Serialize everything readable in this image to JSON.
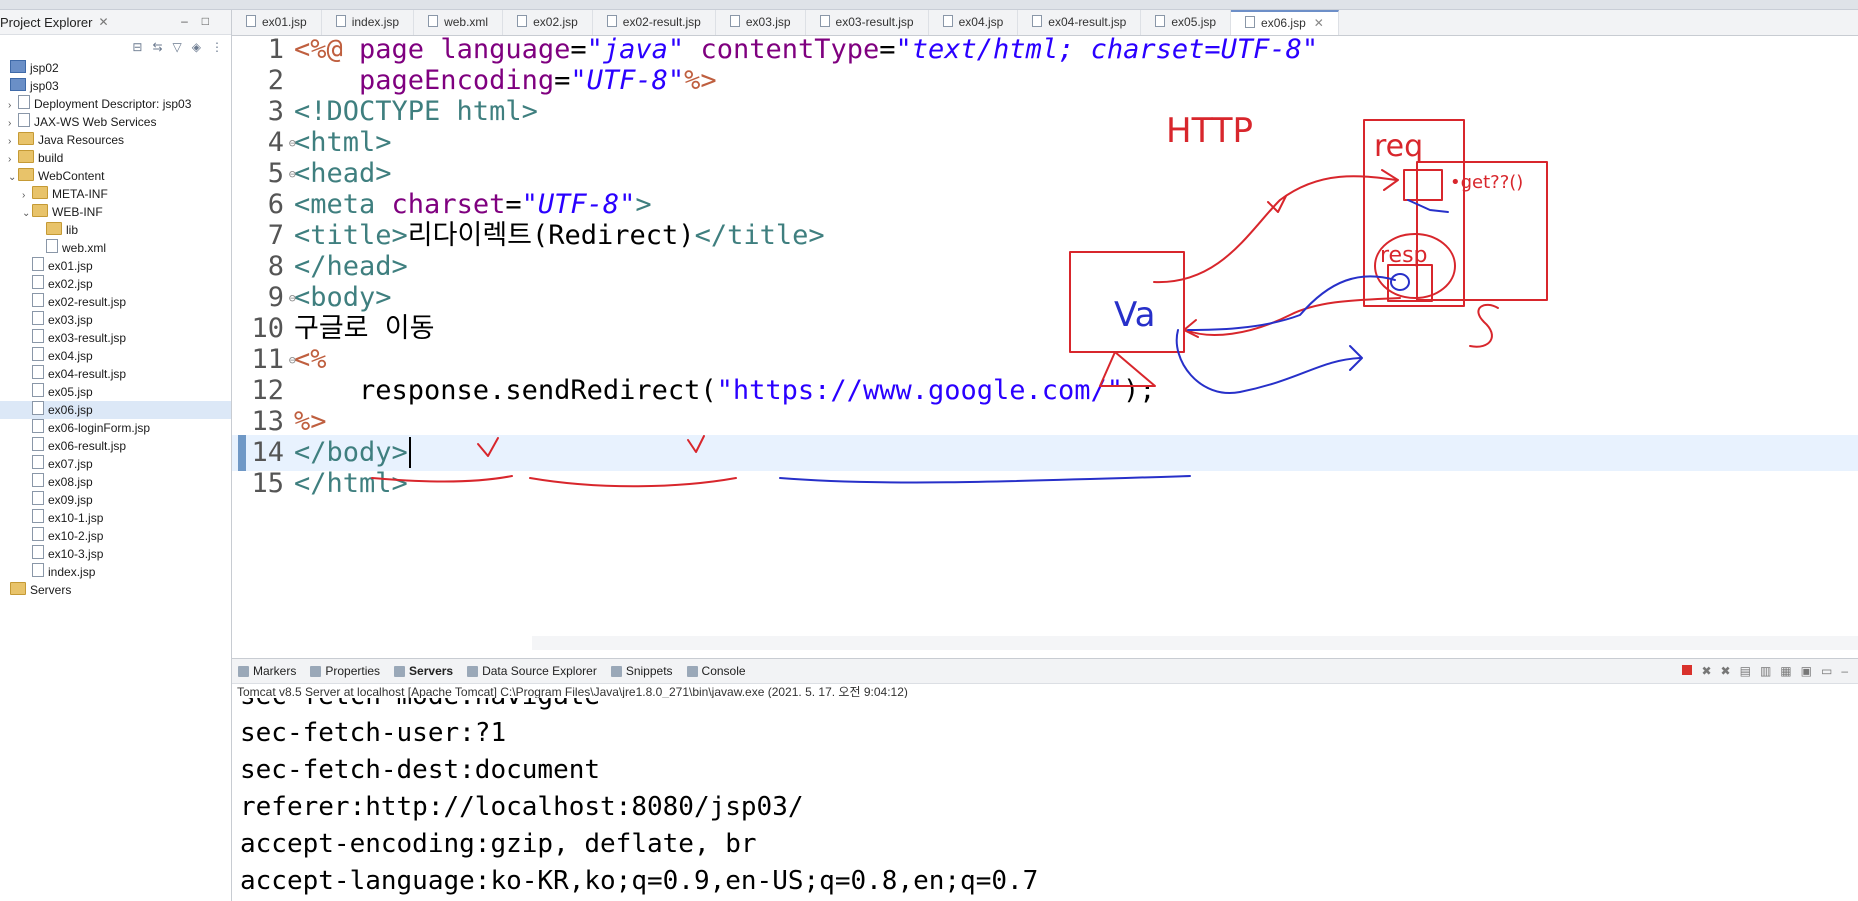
{
  "explorer": {
    "title": "Project Explorer",
    "close": "✕",
    "items": [
      {
        "label": "jsp02",
        "indent": 0,
        "type": "proj",
        "twisty": ""
      },
      {
        "label": "jsp03",
        "indent": 0,
        "type": "proj",
        "twisty": ""
      },
      {
        "label": "Deployment Descriptor: jsp03",
        "indent": 1,
        "type": "file",
        "twisty": "›"
      },
      {
        "label": "JAX-WS Web Services",
        "indent": 1,
        "type": "file",
        "twisty": "›"
      },
      {
        "label": "Java Resources",
        "indent": 1,
        "type": "folder",
        "twisty": "›"
      },
      {
        "label": "build",
        "indent": 1,
        "type": "folder",
        "twisty": "›"
      },
      {
        "label": "WebContent",
        "indent": 1,
        "type": "folder",
        "twisty": "⌄"
      },
      {
        "label": "META-INF",
        "indent": 2,
        "type": "folder",
        "twisty": "›"
      },
      {
        "label": "WEB-INF",
        "indent": 2,
        "type": "folder",
        "twisty": "⌄"
      },
      {
        "label": "lib",
        "indent": 3,
        "type": "folder",
        "twisty": ""
      },
      {
        "label": "web.xml",
        "indent": 3,
        "type": "file",
        "twisty": ""
      },
      {
        "label": "ex01.jsp",
        "indent": 2,
        "type": "file",
        "twisty": ""
      },
      {
        "label": "ex02.jsp",
        "indent": 2,
        "type": "file",
        "twisty": ""
      },
      {
        "label": "ex02-result.jsp",
        "indent": 2,
        "type": "file",
        "twisty": ""
      },
      {
        "label": "ex03.jsp",
        "indent": 2,
        "type": "file",
        "twisty": ""
      },
      {
        "label": "ex03-result.jsp",
        "indent": 2,
        "type": "file",
        "twisty": ""
      },
      {
        "label": "ex04.jsp",
        "indent": 2,
        "type": "file",
        "twisty": ""
      },
      {
        "label": "ex04-result.jsp",
        "indent": 2,
        "type": "file",
        "twisty": ""
      },
      {
        "label": "ex05.jsp",
        "indent": 2,
        "type": "file",
        "twisty": ""
      },
      {
        "label": "ex06.jsp",
        "indent": 2,
        "type": "file",
        "twisty": "",
        "selected": true
      },
      {
        "label": "ex06-loginForm.jsp",
        "indent": 2,
        "type": "file",
        "twisty": ""
      },
      {
        "label": "ex06-result.jsp",
        "indent": 2,
        "type": "file",
        "twisty": ""
      },
      {
        "label": "ex07.jsp",
        "indent": 2,
        "type": "file",
        "twisty": ""
      },
      {
        "label": "ex08.jsp",
        "indent": 2,
        "type": "file",
        "twisty": ""
      },
      {
        "label": "ex09.jsp",
        "indent": 2,
        "type": "file",
        "twisty": ""
      },
      {
        "label": "ex10-1.jsp",
        "indent": 2,
        "type": "file",
        "twisty": ""
      },
      {
        "label": "ex10-2.jsp",
        "indent": 2,
        "type": "file",
        "twisty": ""
      },
      {
        "label": "ex10-3.jsp",
        "indent": 2,
        "type": "file",
        "twisty": ""
      },
      {
        "label": "index.jsp",
        "indent": 2,
        "type": "file",
        "twisty": ""
      },
      {
        "label": "Servers",
        "indent": 0,
        "type": "folder",
        "twisty": ""
      }
    ]
  },
  "tabs": [
    "ex01.jsp",
    "index.jsp",
    "web.xml",
    "ex02.jsp",
    "ex02-result.jsp",
    "ex03.jsp",
    "ex03-result.jsp",
    "ex04.jsp",
    "ex04-result.jsp",
    "ex05.jsp",
    "ex06.jsp"
  ],
  "active_tab": "ex06.jsp",
  "editor": {
    "lines": [
      {
        "n": "1",
        "fold": "",
        "parts": [
          [
            "dir",
            "<%@ "
          ],
          [
            "attr",
            "page "
          ],
          [
            "attr",
            "language"
          ],
          [
            "txt",
            "="
          ],
          [
            "str",
            "\"java\""
          ],
          [
            "txt",
            " "
          ],
          [
            "attr",
            "contentType"
          ],
          [
            "txt",
            "="
          ],
          [
            "str",
            "\"text/html; charset=UTF-8\""
          ]
        ]
      },
      {
        "n": "2",
        "fold": "",
        "parts": [
          [
            "txt",
            "    "
          ],
          [
            "attr",
            "pageEncoding"
          ],
          [
            "txt",
            "="
          ],
          [
            "str",
            "\"UTF-8\""
          ],
          [
            "dir",
            "%>"
          ]
        ]
      },
      {
        "n": "3",
        "fold": "",
        "parts": [
          [
            "tag",
            "<!DOCTYPE html>"
          ]
        ]
      },
      {
        "n": "4",
        "fold": "⊖",
        "parts": [
          [
            "tag",
            "<html>"
          ]
        ]
      },
      {
        "n": "5",
        "fold": "⊖",
        "parts": [
          [
            "tag",
            "<head>"
          ]
        ]
      },
      {
        "n": "6",
        "fold": "",
        "parts": [
          [
            "tag",
            "<meta "
          ],
          [
            "attr",
            "charset"
          ],
          [
            "txt",
            "="
          ],
          [
            "str",
            "\"UTF-8\""
          ],
          [
            "tag",
            ">"
          ]
        ]
      },
      {
        "n": "7",
        "fold": "",
        "parts": [
          [
            "tag",
            "<title>"
          ],
          [
            "txt",
            "리다이렉트(Redirect)"
          ],
          [
            "tag",
            "</title>"
          ]
        ]
      },
      {
        "n": "8",
        "fold": "",
        "parts": [
          [
            "tag",
            "</head>"
          ]
        ]
      },
      {
        "n": "9",
        "fold": "⊖",
        "parts": [
          [
            "tag",
            "<body>"
          ]
        ]
      },
      {
        "n": "10",
        "fold": "",
        "parts": [
          [
            "txt",
            "구글로 이동"
          ]
        ]
      },
      {
        "n": "11",
        "fold": "⊖",
        "parts": [
          [
            "dir",
            "<%"
          ]
        ]
      },
      {
        "n": "12",
        "fold": "",
        "parts": [
          [
            "txt",
            "    response.sendRedirect("
          ],
          [
            "str2",
            "\"https://www.google.com/\""
          ],
          [
            "txt",
            ");"
          ]
        ]
      },
      {
        "n": "13",
        "fold": "",
        "parts": [
          [
            "dir",
            "%>"
          ]
        ]
      },
      {
        "n": "14",
        "fold": "",
        "parts": [
          [
            "tag",
            "</body>"
          ]
        ],
        "current": true
      },
      {
        "n": "15",
        "fold": "",
        "parts": [
          [
            "tag",
            "</html>"
          ]
        ]
      }
    ]
  },
  "annotations": {
    "http": "HTTP",
    "req": "req",
    "get": "•get??()",
    "resp": "resp",
    "client": "Va",
    "server": "S",
    "colors": {
      "red": "#d8262c",
      "blue": "#2730c9"
    }
  },
  "panel": {
    "tabs": [
      {
        "label": "Markers",
        "active": false
      },
      {
        "label": "Properties",
        "active": false
      },
      {
        "label": "Servers",
        "active": true
      },
      {
        "label": "Data Source Explorer",
        "active": false
      },
      {
        "label": "Snippets",
        "active": false
      },
      {
        "label": "Console",
        "active": false
      }
    ],
    "server_line": "Tomcat v8.5 Server at localhost [Apache Tomcat] C:\\Program Files\\Java\\jre1.8.0_271\\bin\\javaw.exe  (2021. 5. 17. 오전 9:04:12)",
    "console_lines": [
      "sec-fetch-mode:navigate",
      "sec-fetch-user:?1",
      "sec-fetch-dest:document",
      "referer:http://localhost:8080/jsp03/",
      "accept-encoding:gzip, deflate, br",
      "accept-language:ko-KR,ko;q=0.9,en-US;q=0.8,en;q=0.7"
    ]
  }
}
